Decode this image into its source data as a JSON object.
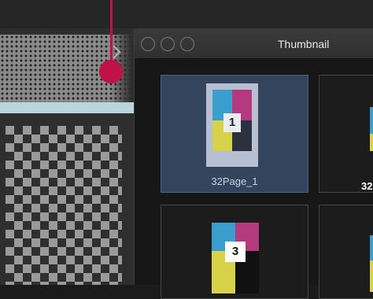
{
  "thumbnail_window": {
    "title": "Thumbnail",
    "tiles": [
      {
        "label": "32Page_1",
        "page_number": "1",
        "selected": true
      },
      {
        "label": "32",
        "page_number": "",
        "selected": false
      },
      {
        "label": "",
        "page_number": "3",
        "selected": false
      },
      {
        "label": "",
        "page_number": "",
        "selected": false
      }
    ]
  },
  "colors": {
    "callout": "#c0114a",
    "selection": "#34445c",
    "cyan": "#3a9fcf",
    "magenta": "#b4397e",
    "yellow": "#d8d24a",
    "black": "#111111"
  }
}
